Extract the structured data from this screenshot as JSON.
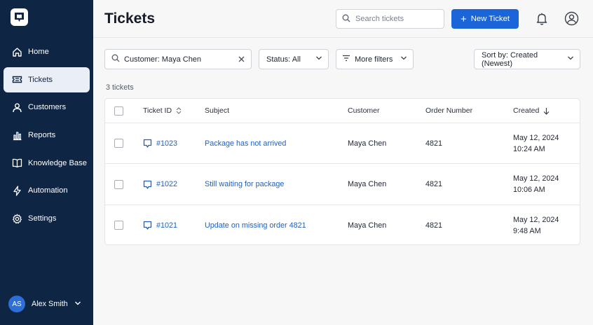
{
  "sidebar": {
    "items": [
      {
        "label": "Home",
        "icon": "home-icon"
      },
      {
        "label": "Tickets",
        "icon": "ticket-icon",
        "active": true
      },
      {
        "label": "Customers",
        "icon": "user-icon"
      },
      {
        "label": "Reports",
        "icon": "bar-chart-icon"
      },
      {
        "label": "Knowledge Base",
        "icon": "book-icon"
      },
      {
        "label": "Automation",
        "icon": "bolt-icon"
      },
      {
        "label": "Settings",
        "icon": "gear-icon"
      }
    ],
    "user": {
      "initials": "AS",
      "name": "Alex Smith"
    }
  },
  "header": {
    "title": "Tickets",
    "search_placeholder": "Search tickets",
    "new_ticket_label": "New Ticket"
  },
  "filters": {
    "customer": "Customer: Maya Chen",
    "status": "Status: All",
    "more": "More filters",
    "sort": "Sort by: Created (Newest)"
  },
  "ticket_count": "3 tickets",
  "table": {
    "columns": [
      "Ticket ID",
      "Subject",
      "Customer",
      "Order Number",
      "Created"
    ],
    "rows": [
      {
        "id": "#1023",
        "subject": "Package has not arrived",
        "customer": "Maya Chen",
        "order": "4821",
        "date": "May 12, 2024",
        "time": "10:24 AM"
      },
      {
        "id": "#1022",
        "subject": "Still waiting for package",
        "customer": "Maya Chen",
        "order": "4821",
        "date": "May 12, 2024",
        "time": "10:06 AM"
      },
      {
        "id": "#1021",
        "subject": "Update on missing order 4821",
        "customer": "Maya Chen",
        "order": "4821",
        "date": "May 12, 2024",
        "time": "9:48 AM"
      }
    ]
  },
  "colors": {
    "sidebar_bg": "#0f2544",
    "accent": "#1a66d9",
    "link": "#1f5fbf",
    "active_item_bg": "#e9eef7"
  }
}
